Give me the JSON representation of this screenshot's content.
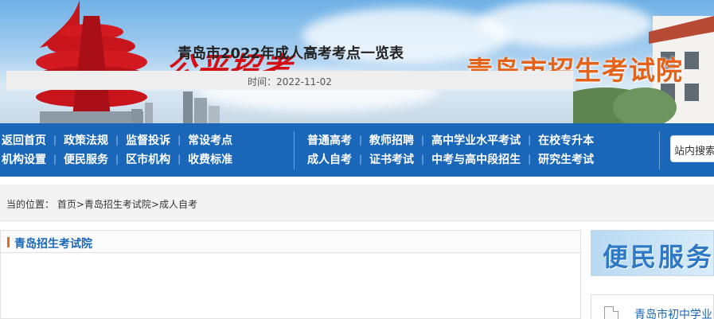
{
  "header": {
    "slogan": "公平招考",
    "org_name": "青岛市招生考试院"
  },
  "nav": {
    "row1": [
      "返回首页",
      "政策法规",
      "监督投诉",
      "常设考点",
      "普通高考",
      "教师招聘",
      "高中学业水平考试",
      "在校专升本"
    ],
    "row2": [
      "机构设置",
      "便民服务",
      "区市机构",
      "收费标准",
      "成人自考",
      "证书考试",
      "中考与高中段招生",
      "研究生考试"
    ],
    "search_placeholder": "站内搜索"
  },
  "breadcrumb": {
    "label": "当的位置：",
    "home": "首页",
    "sep1": ">",
    "level1": "青岛招生考试院",
    "sep2": ">",
    "level2": "成人自考"
  },
  "panel": {
    "header": "青岛招生考试院",
    "article_title": "青岛市2022年成人高考考点一览表",
    "meta": "时间：2022-11-02"
  },
  "side": {
    "banner": "便民服务",
    "item1": "青岛市初中学业"
  },
  "colors": {
    "nav_bg": "#1a66b8",
    "accent_orange": "#e5621a",
    "slogan_red": "#d40f14"
  }
}
